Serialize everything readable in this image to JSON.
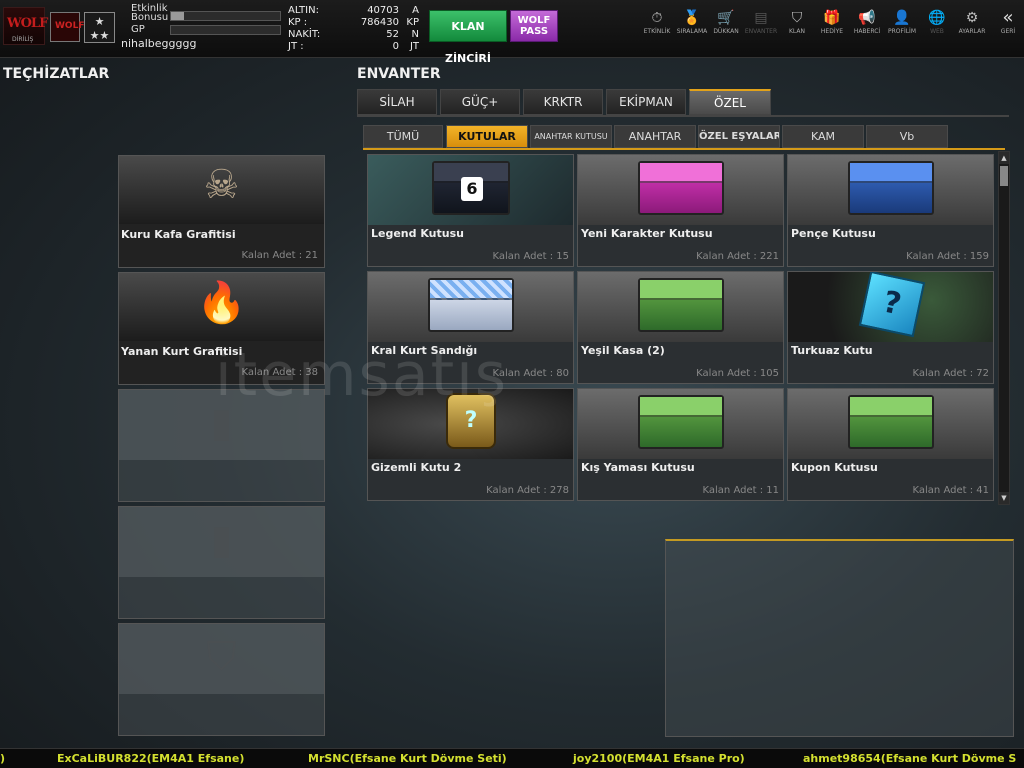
{
  "header": {
    "bonus_label": "Etkinlik\nBonusu",
    "gp_label": "GP",
    "bonus_progress": 0.12,
    "gp_progress": 0.0,
    "username": "nihalbeggggg",
    "stats": [
      {
        "key": "ALTIN:",
        "value": "40703",
        "unit": "A"
      },
      {
        "key": "KP :",
        "value": "786430",
        "unit": "KP"
      },
      {
        "key": "NAKİT:",
        "value": "52",
        "unit": "N"
      },
      {
        "key": "JT :",
        "value": "0",
        "unit": "JT"
      }
    ],
    "klan_button": "KLAN ZİNCİRİ",
    "wolf_button_line1": "WOLF",
    "wolf_button_line2": "PASS",
    "nav": [
      {
        "label": "ETKİNLİK",
        "icon": "stopwatch-icon",
        "glyph": "⏱"
      },
      {
        "label": "SIRALAMA",
        "icon": "medal-icon",
        "glyph": "🏅"
      },
      {
        "label": "DÜKKAN",
        "icon": "cart-icon",
        "glyph": "🛒"
      },
      {
        "label": "ENVANTER",
        "icon": "inventory-icon",
        "glyph": "▤"
      },
      {
        "label": "KLAN",
        "icon": "shield-icon",
        "glyph": "⛉"
      },
      {
        "label": "HEDİYE",
        "icon": "gift-icon",
        "glyph": "🎁"
      },
      {
        "label": "HABERCİ",
        "icon": "megaphone-icon",
        "glyph": "📢"
      },
      {
        "label": "PROFİLİM",
        "icon": "profile-icon",
        "glyph": "👤"
      },
      {
        "label": "WEB",
        "icon": "globe-icon",
        "glyph": "🌐"
      },
      {
        "label": "AYARLAR",
        "icon": "gear-icon",
        "glyph": "⚙"
      }
    ],
    "back_label": "GERİ"
  },
  "left": {
    "title": "TEÇHİZATLAR",
    "slots": [
      {
        "name": "Kuru Kafa Grafitisi",
        "count": "Kalan Adet : 21"
      },
      {
        "name": "Yanan Kurt Grafitisi",
        "count": "Kalan Adet : 38"
      }
    ]
  },
  "inventory": {
    "title": "ENVANTER",
    "tabs": [
      "SİLAH",
      "GÜÇ+",
      "KRKTR",
      "EKİPMAN",
      "ÖZEL"
    ],
    "subtabs": [
      "TÜMÜ",
      "KUTULAR",
      "ANAHTAR KUTUSU",
      "ANAHTAR",
      "ÖZEL EŞYALAR",
      "KAM",
      "Vb"
    ],
    "items": [
      {
        "name": "Legend Kutusu",
        "count": "Kalan Adet : 15"
      },
      {
        "name": "Yeni Karakter Kutusu",
        "count": "Kalan Adet : 221"
      },
      {
        "name": "Pençe Kutusu",
        "count": "Kalan Adet : 159"
      },
      {
        "name": "Kral Kurt Sandığı",
        "count": "Kalan Adet : 80"
      },
      {
        "name": "Yeşil Kasa (2)",
        "count": "Kalan Adet : 105"
      },
      {
        "name": "Turkuaz Kutu",
        "count": "Kalan Adet : 72"
      },
      {
        "name": "Gizemli Kutu 2",
        "count": "Kalan Adet : 278"
      },
      {
        "name": "Kış Yaması Kutusu",
        "count": "Kalan Adet : 11"
      },
      {
        "name": "Kupon Kutusu",
        "count": "Kalan Adet : 41"
      }
    ]
  },
  "ticker": [
    ")",
    "ExCaLiBUR822(EM4A1 Efsane)",
    "MrSNC(Efsane Kurt Dövme Seti)",
    "joy2100(EM4A1 Efsane Pro)",
    "ahmet98654(Efsane Kurt Dövme S"
  ],
  "watermark": "itemsatış"
}
